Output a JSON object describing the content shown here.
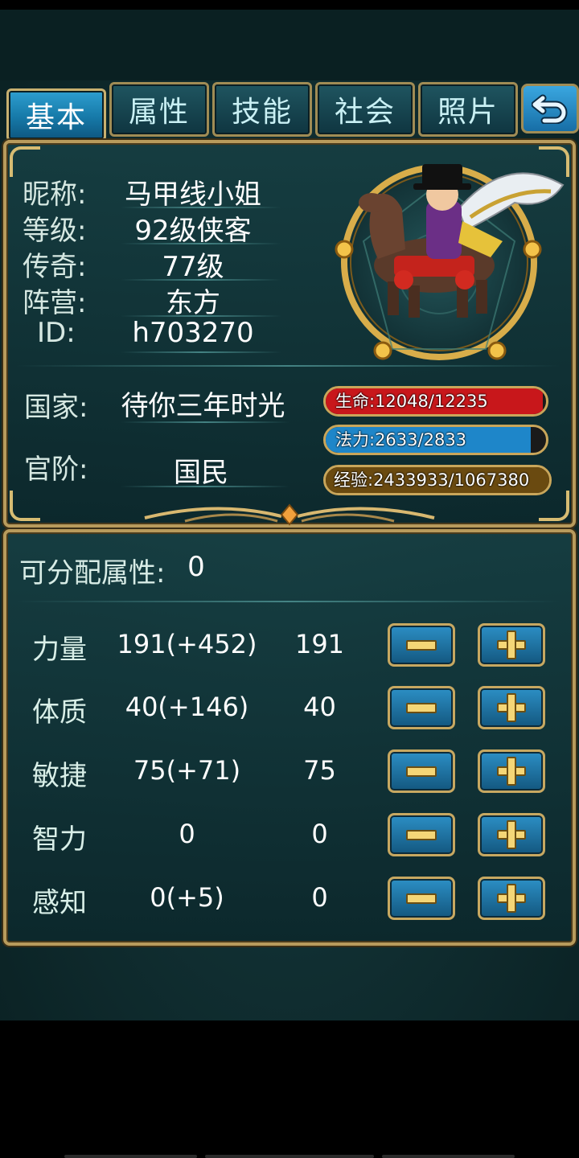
{
  "tabs": [
    {
      "label": "基本",
      "active": true
    },
    {
      "label": "属性",
      "active": false
    },
    {
      "label": "技能",
      "active": false
    },
    {
      "label": "社会",
      "active": false
    },
    {
      "label": "照片",
      "active": false
    }
  ],
  "profile": {
    "nickname_label": "昵称:",
    "nickname": "马甲线小姐",
    "level_label": "等级:",
    "level": "92级侠客",
    "legend_label": "传奇:",
    "legend": "77级",
    "camp_label": "阵营:",
    "camp": "东方",
    "id_label": "ID:",
    "id": "h703270",
    "country_label": "国家:",
    "country": "待你三年时光",
    "rank_label": "官阶:",
    "rank": "国民"
  },
  "bars": {
    "hp": {
      "text": "生命:12048/12235",
      "fraction": 0.985,
      "color": "#c8171b"
    },
    "mp": {
      "text": "法力:2633/2833",
      "fraction": 0.93,
      "color": "#1e86c9"
    },
    "exp": {
      "text": "经验:2433933/1067380",
      "fraction": 1.0,
      "color": "#6a4a10"
    }
  },
  "attributes": {
    "free_label": "可分配属性:",
    "free_value": "0",
    "stats": [
      {
        "name": "力量",
        "total": "191(+452)",
        "base": "191"
      },
      {
        "name": "体质",
        "total": "40(+146)",
        "base": "40"
      },
      {
        "name": "敏捷",
        "total": "75(+71)",
        "base": "75"
      },
      {
        "name": "智力",
        "total": "0",
        "base": "0"
      },
      {
        "name": "感知",
        "total": "0(+5)",
        "base": "0"
      }
    ]
  },
  "icons": {
    "back": "back-arrow-icon",
    "minus": "minus-icon",
    "plus": "plus-icon",
    "avatar": "rider-on-horse-avatar"
  },
  "colors": {
    "frame_gold": "#b89b5c",
    "tab_active": "#1f8fc4",
    "panel_teal": "#123a3e"
  }
}
